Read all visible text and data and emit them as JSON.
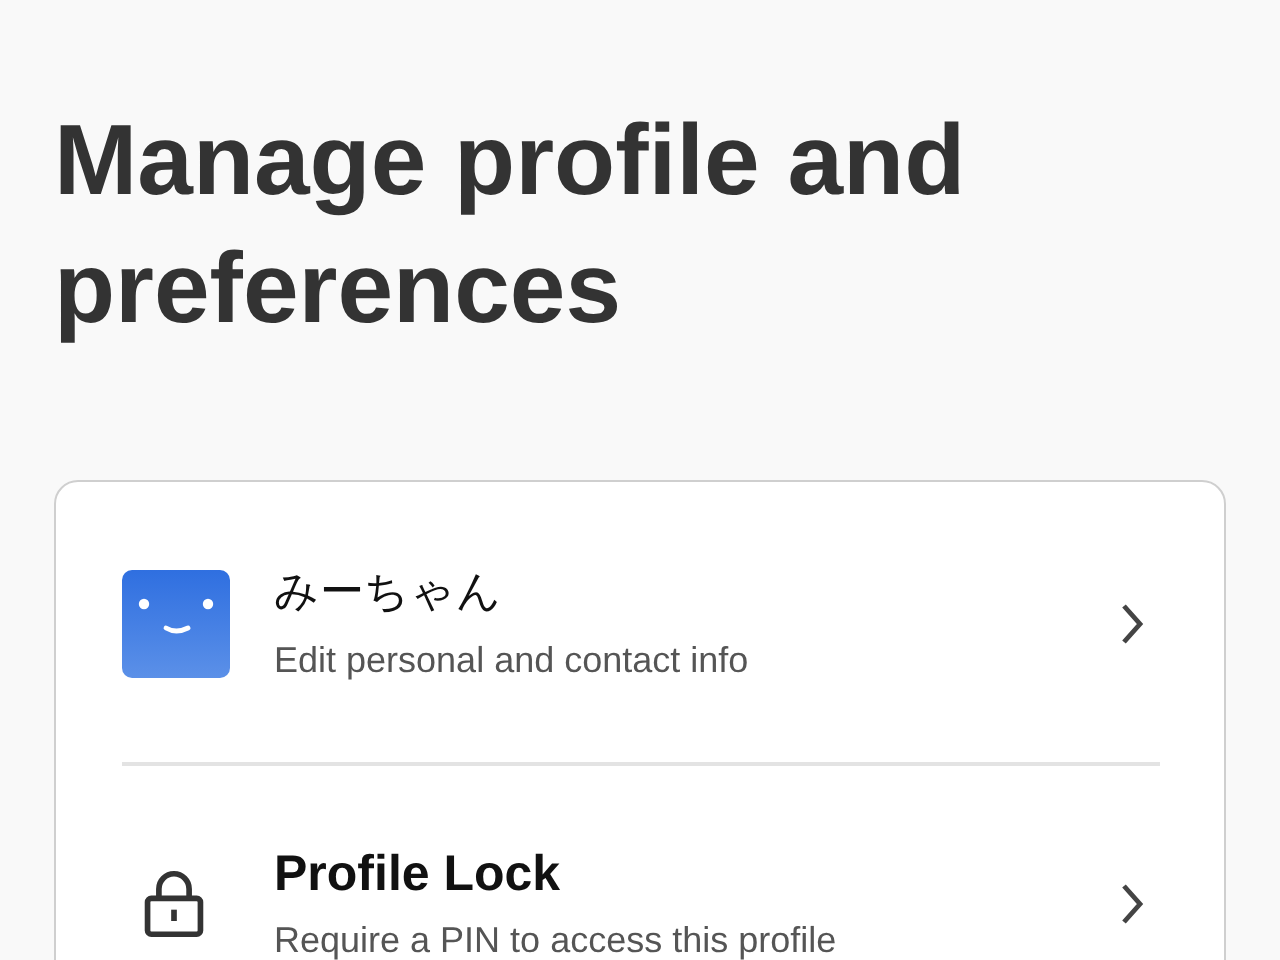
{
  "page": {
    "title": "Manage profile and preferences"
  },
  "items": [
    {
      "kind": "profile",
      "title": "みーちゃん",
      "subtitle": "Edit personal and contact info"
    },
    {
      "kind": "lock",
      "title": "Profile Lock",
      "subtitle": "Require a PIN to access this profile"
    }
  ]
}
